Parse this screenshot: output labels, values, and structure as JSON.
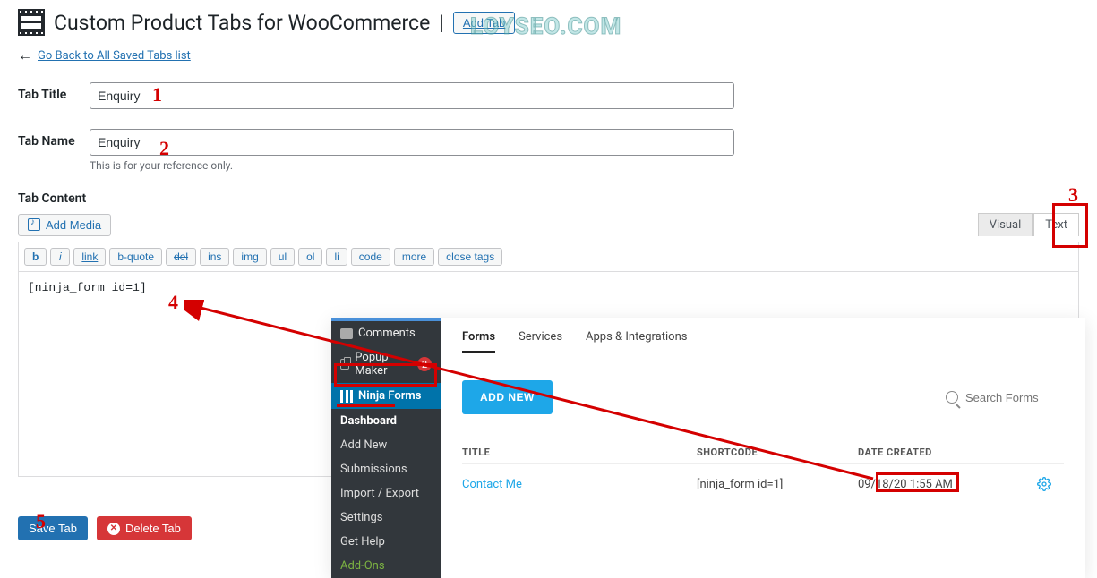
{
  "page": {
    "title": "Custom Product Tabs for WooCommerce",
    "title_sep": " | ",
    "add_tab_btn": "Add Tab",
    "back_link": "Go Back to All Saved Tabs list"
  },
  "watermark": "LOYSEO.COM",
  "fields": {
    "tab_title_label": "Tab Title",
    "tab_title_value": "Enquiry",
    "tab_name_label": "Tab Name",
    "tab_name_value": "Enquiry",
    "tab_name_help": "This is for your reference only.",
    "tab_content_label": "Tab Content"
  },
  "editor": {
    "add_media": "Add Media",
    "tabs": {
      "visual": "Visual",
      "text": "Text"
    },
    "quicktags": [
      "b",
      "i",
      "link",
      "b-quote",
      "del",
      "ins",
      "img",
      "ul",
      "ol",
      "li",
      "code",
      "more",
      "close tags"
    ],
    "content": "[ninja_form id=1]"
  },
  "actions": {
    "save": "Save Tab",
    "delete": "Delete Tab"
  },
  "wp_submenu": {
    "comments": "Comments",
    "popup_maker": "Popup Maker",
    "popup_maker_badge": "2",
    "ninja_forms": "Ninja Forms",
    "items": [
      "Dashboard",
      "Add New",
      "Submissions",
      "Import / Export",
      "Settings",
      "Get Help",
      "Add-Ons"
    ]
  },
  "nf_dashboard": {
    "tabs": [
      "Forms",
      "Services",
      "Apps & Integrations"
    ],
    "add_new": "ADD NEW",
    "search_placeholder": "Search Forms",
    "columns": {
      "title": "TITLE",
      "shortcode": "SHORTCODE",
      "date": "DATE CREATED"
    },
    "row": {
      "title": "Contact Me",
      "shortcode": "[ninja_form id=1]",
      "date": "09/18/20 1:55 AM"
    }
  },
  "annotations": {
    "n1": "1",
    "n2": "2",
    "n3": "3",
    "n4": "4",
    "n5": "5"
  }
}
